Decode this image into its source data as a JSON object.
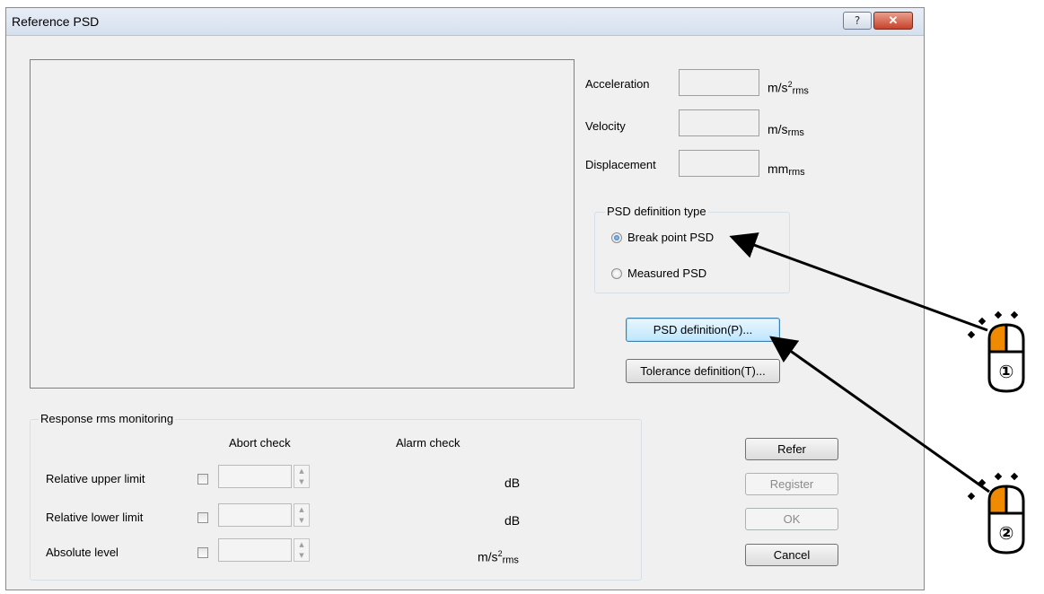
{
  "dialog": {
    "title": "Reference PSD",
    "help_label": "?",
    "close_label": "✕"
  },
  "rms_fields": [
    {
      "label": "Acceleration",
      "unit_main": "m/s",
      "unit_sup": "2",
      "unit_sub": "rms"
    },
    {
      "label": "Velocity",
      "unit_main": "m/s",
      "unit_sup": "",
      "unit_sub": "rms"
    },
    {
      "label": "Displacement",
      "unit_main": "mm",
      "unit_sup": "",
      "unit_sub": "rms"
    }
  ],
  "psd_type": {
    "title": "PSD definition type",
    "options": [
      "Break point PSD",
      "Measured PSD"
    ],
    "selected": "Break point PSD"
  },
  "buttons": {
    "psd_definition": "PSD definition(P)...",
    "tolerance_definition": "Tolerance definition(T)...",
    "refer": "Refer",
    "register": "Register",
    "ok": "OK",
    "cancel": "Cancel"
  },
  "monitoring": {
    "title": "Response rms monitoring",
    "col_abort": "Abort check",
    "col_alarm": "Alarm check",
    "rows": [
      {
        "label": "Relative upper limit",
        "unit": "dB",
        "unit_sup": "",
        "unit_sub": ""
      },
      {
        "label": "Relative lower limit",
        "unit": "dB",
        "unit_sup": "",
        "unit_sub": ""
      },
      {
        "label": "Absolute level",
        "unit": "m/s",
        "unit_sup": "2",
        "unit_sub": "rms"
      }
    ]
  },
  "callouts": [
    {
      "number": "①",
      "target": "Break point PSD"
    },
    {
      "number": "②",
      "target": "PSD definition(P)..."
    }
  ],
  "colors": {
    "mouse_button": "#f08a00",
    "arrow": "#000000"
  }
}
